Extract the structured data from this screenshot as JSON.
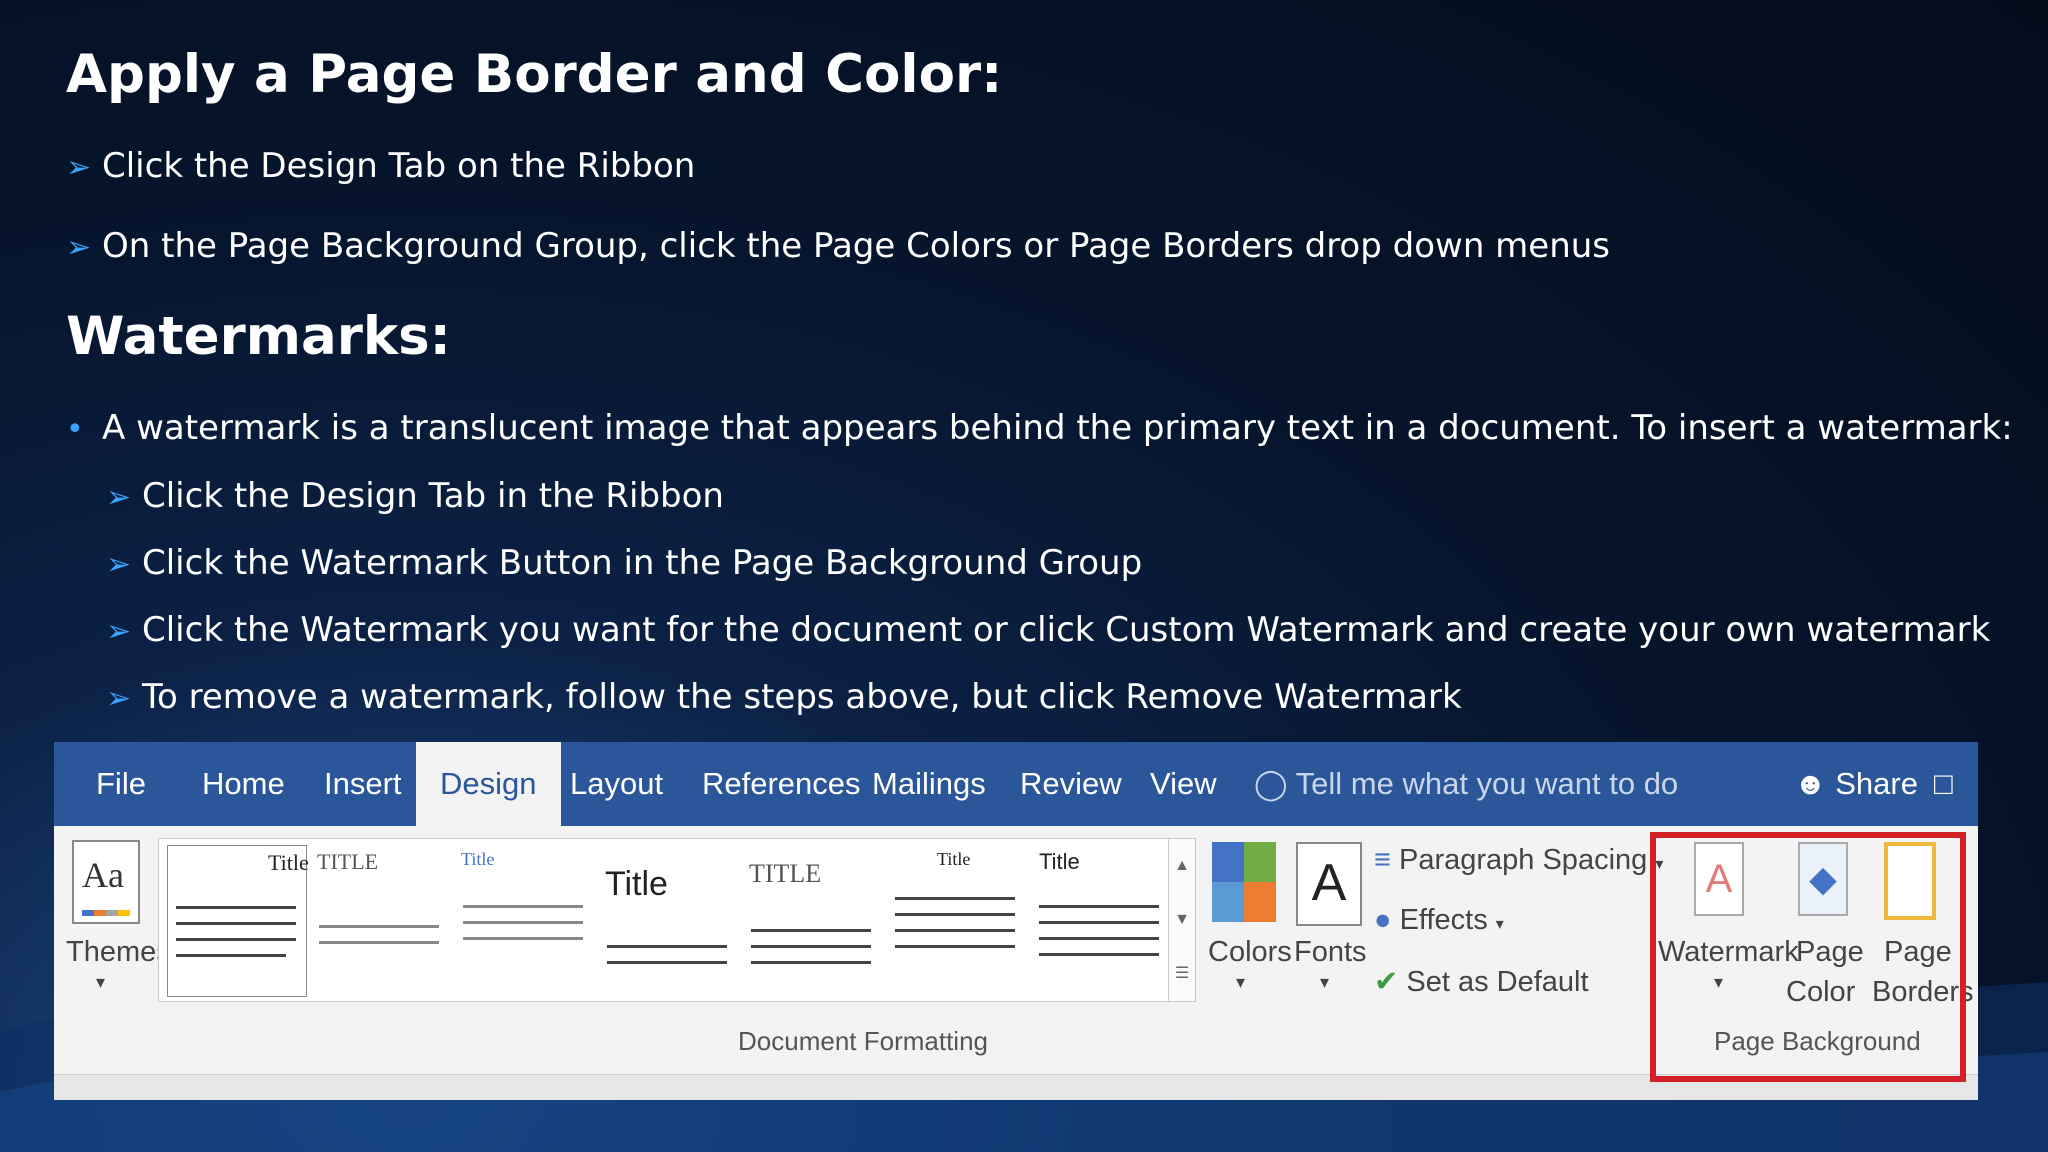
{
  "slide": {
    "heading1": "Apply a Page Border and Color:",
    "steps1": [
      "Click the Design Tab on the Ribbon",
      "On the Page Background Group, click the Page Colors or Page Borders drop down menus"
    ],
    "heading2": "Watermarks:",
    "bullet": "A watermark is a translucent image that appears behind the primary text in a document. To insert a watermark:",
    "steps2": [
      "Click the Design Tab in the Ribbon",
      "Click the Watermark Button in the Page Background Group",
      "Click the Watermark you want for the document or click Custom Watermark and create your own watermark",
      "To remove a watermark, follow the steps above, but click Remove Watermark"
    ],
    "arrow_glyph": "➢",
    "bullet_glyph": "•"
  },
  "ribbon": {
    "tabs": [
      "File",
      "Home",
      "Insert",
      "Design",
      "Layout",
      "References",
      "Mailings",
      "Review",
      "View"
    ],
    "active_tab": "Design",
    "tell_me": "Tell me what you want to do",
    "share": "Share",
    "themes": "Themes",
    "colors": "Colors",
    "fonts": "Fonts",
    "paragraph_spacing": "Paragraph Spacing",
    "effects": "Effects",
    "set_default": "Set as Default",
    "doc_formatting": "Document Formatting",
    "watermark": "Watermark",
    "page_color": [
      "Page",
      "Color"
    ],
    "page_borders": [
      "Page",
      "Borders"
    ],
    "page_background": "Page Background",
    "style_thumbs": [
      "Title",
      "TITLE",
      "Title",
      "Title",
      "TITLE",
      "Title",
      "Title"
    ],
    "accent_color": "#2b579a",
    "highlight_color": "#d31f26"
  }
}
